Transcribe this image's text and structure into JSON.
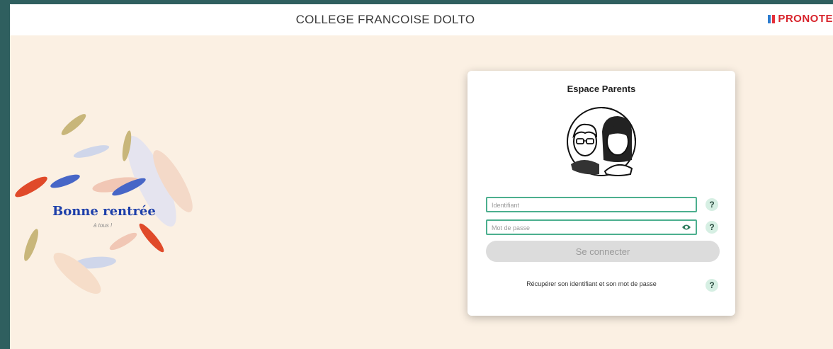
{
  "header": {
    "school_name": "COLLEGE FRANCOISE DOLTO",
    "brand": "PRONOTE"
  },
  "welcome": {
    "title": "Bonne rentrée",
    "subtitle": "à tous !"
  },
  "login": {
    "title": "Espace Parents",
    "username_placeholder": "Identifiant",
    "password_placeholder": "Mot de passe",
    "help_label": "?",
    "connect_label": "Se connecter",
    "recover_label": "Récupérer son identifiant et son mot de passe"
  },
  "colors": {
    "field_border": "#4caf8e",
    "help_bg": "#d6efe3",
    "brand_red": "#d8242c",
    "welcome_blue": "#1d3faa"
  }
}
